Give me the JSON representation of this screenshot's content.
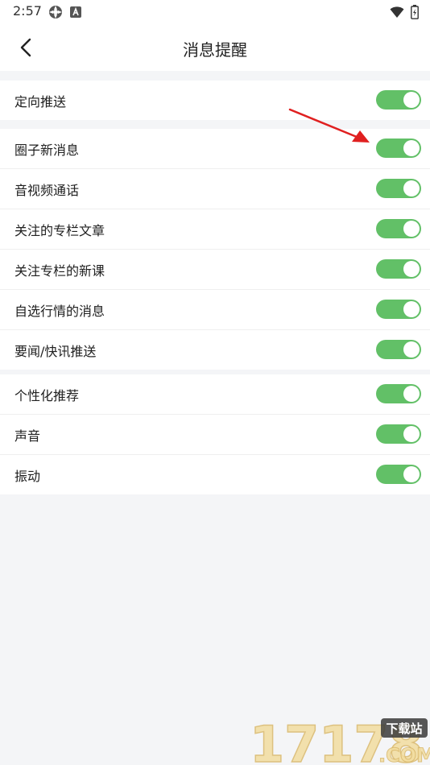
{
  "status_bar": {
    "time": "2:57"
  },
  "header": {
    "title": "消息提醒"
  },
  "groups": [
    {
      "items": [
        {
          "label": "定向推送",
          "on": true
        }
      ]
    },
    {
      "items": [
        {
          "label": "圈子新消息",
          "on": true
        },
        {
          "label": "音视频通话",
          "on": true
        },
        {
          "label": "关注的专栏文章",
          "on": true
        },
        {
          "label": "关注专栏的新课",
          "on": true
        },
        {
          "label": "自选行情的消息",
          "on": true
        },
        {
          "label": "要闻/快讯推送",
          "on": true
        }
      ]
    },
    {
      "items": [
        {
          "label": "个性化推荐",
          "on": true
        },
        {
          "label": "声音",
          "on": true
        },
        {
          "label": "振动",
          "on": true
        }
      ]
    }
  ],
  "watermark": {
    "logo_text": "17178",
    "badge_text": "下载站",
    "domain": ".COM"
  },
  "colors": {
    "toggle_on": "#62c067",
    "annotation_arrow": "#e02020",
    "background": "#f4f5f7"
  },
  "icons": [
    "android-settings-icon",
    "accessibility-icon",
    "wifi-icon",
    "battery-icon",
    "back-arrow-icon"
  ]
}
